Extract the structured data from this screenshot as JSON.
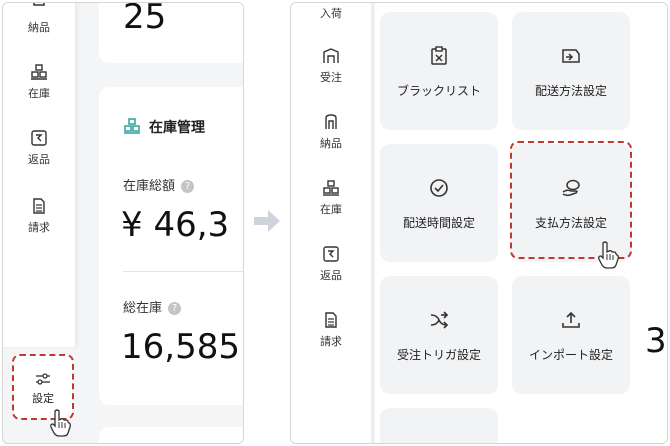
{
  "left": {
    "sidebar": [
      {
        "label": "納品",
        "icon": "delivery-icon"
      },
      {
        "label": "在庫",
        "icon": "inventory-icon"
      },
      {
        "label": "返品",
        "icon": "return-icon"
      },
      {
        "label": "請求",
        "icon": "invoice-icon"
      }
    ],
    "settings_label": "設定",
    "top_value": "25",
    "inventory_card": {
      "title": "在庫管理",
      "total_amount_label": "在庫総額",
      "total_amount_value": "¥ 46,3",
      "total_stock_label": "総在庫",
      "total_stock_value": "16,585"
    },
    "help_glyph": "?"
  },
  "right": {
    "sidebar": [
      {
        "label": "入荷",
        "icon": "arrival-icon"
      },
      {
        "label": "受注",
        "icon": "order-icon"
      },
      {
        "label": "納品",
        "icon": "delivery-icon"
      },
      {
        "label": "在庫",
        "icon": "inventory-icon"
      },
      {
        "label": "返品",
        "icon": "return-icon"
      },
      {
        "label": "請求",
        "icon": "invoice-icon"
      }
    ],
    "tiles": [
      {
        "label": "ブラックリスト",
        "icon": "blacklist-icon"
      },
      {
        "label": "配送方法設定",
        "icon": "shipping-method-icon"
      },
      {
        "label": "配送時間設定",
        "icon": "clock-icon"
      },
      {
        "label": "支払方法設定",
        "icon": "payment-icon"
      },
      {
        "label": "受注トリガ設定",
        "icon": "trigger-icon"
      },
      {
        "label": "インポート設定",
        "icon": "import-icon"
      }
    ],
    "peek_digit": "3"
  },
  "colors": {
    "accent": "#3aa6a0",
    "highlight": "#c0392b",
    "arrow": "#cfd4dc"
  }
}
